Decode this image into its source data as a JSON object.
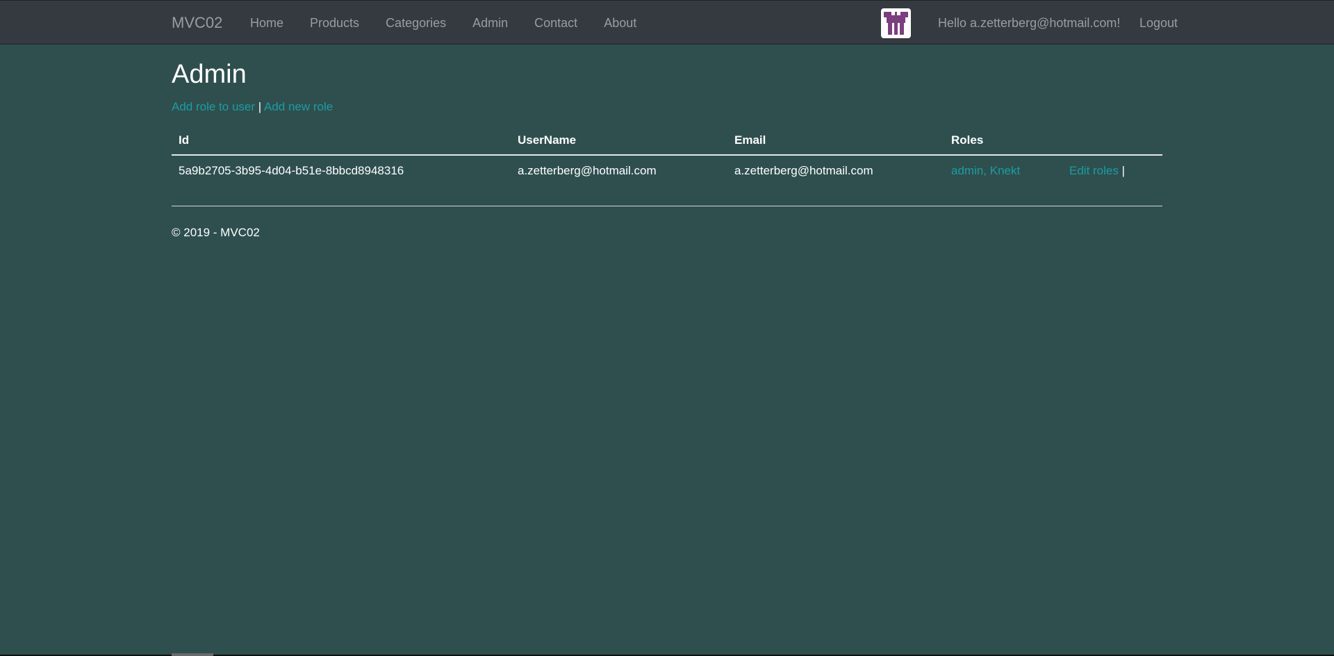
{
  "navbar": {
    "brand": "MVC02",
    "links": [
      {
        "label": "Home"
      },
      {
        "label": "Products"
      },
      {
        "label": "Categories"
      },
      {
        "label": "Admin"
      },
      {
        "label": "Contact"
      },
      {
        "label": "About"
      }
    ],
    "greeting": "Hello a.zetterberg@hotmail.com!",
    "logout": "Logout",
    "avatar_color": "#7b3f7e"
  },
  "main": {
    "title": "Admin",
    "add_role_to_user": "Add role to user",
    "separator": "|",
    "add_new_role": "Add new role",
    "table": {
      "headers": [
        "Id",
        "UserName",
        "Email",
        "Roles",
        ""
      ],
      "rows": [
        {
          "id": "5a9b2705-3b95-4d04-b51e-8bbcd8948316",
          "username": "a.zetterberg@hotmail.com",
          "email": "a.zetterberg@hotmail.com",
          "roles": "admin, Knekt",
          "edit": "Edit roles",
          "trailing": "|"
        }
      ]
    }
  },
  "footer": {
    "copyright": "© 2019 - MVC02"
  },
  "colors": {
    "background": "#2f4f4f",
    "navbar": "#343a40",
    "link": "#1b9da1",
    "nav_text": "#9a9da0"
  }
}
